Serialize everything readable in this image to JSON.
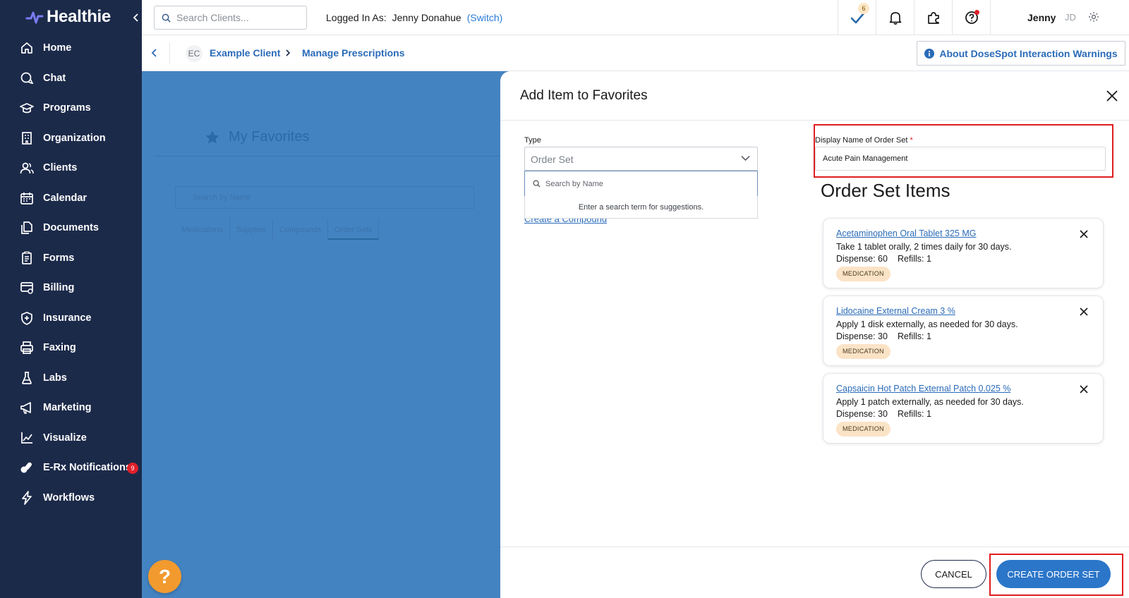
{
  "brand": {
    "name": "Healthie"
  },
  "sidebar": {
    "items": [
      {
        "label": "Home",
        "icon": "home-icon"
      },
      {
        "label": "Chat",
        "icon": "chat-icon"
      },
      {
        "label": "Programs",
        "icon": "programs-icon"
      },
      {
        "label": "Organization",
        "icon": "building-icon"
      },
      {
        "label": "Clients",
        "icon": "users-icon"
      },
      {
        "label": "Calendar",
        "icon": "calendar-icon"
      },
      {
        "label": "Documents",
        "icon": "documents-icon"
      },
      {
        "label": "Forms",
        "icon": "forms-icon"
      },
      {
        "label": "Billing",
        "icon": "billing-icon"
      },
      {
        "label": "Insurance",
        "icon": "shield-icon"
      },
      {
        "label": "Faxing",
        "icon": "printer-icon"
      },
      {
        "label": "Labs",
        "icon": "flask-icon"
      },
      {
        "label": "Marketing",
        "icon": "megaphone-icon"
      },
      {
        "label": "Visualize",
        "icon": "chart-icon"
      },
      {
        "label": "E-Rx Notifications",
        "icon": "pills-icon",
        "badge": "9"
      },
      {
        "label": "Workflows",
        "icon": "lightning-icon"
      }
    ]
  },
  "topbar": {
    "search_placeholder": "Search Clients...",
    "logged_in_label": "Logged In As:",
    "user_full_name": "Jenny Donahue",
    "switch_label": "(Switch)",
    "tasks_count": "6",
    "user_first_name": "Jenny",
    "user_initials": "JD"
  },
  "subbar": {
    "client_initials": "EC",
    "client_name": "Example Client",
    "page_name": "Manage Prescriptions",
    "about_button": "About DoseSpot Interaction Warnings"
  },
  "background": {
    "title": "My Favorites",
    "search_placeholder": "Search by Name",
    "tabs": [
      "Medications",
      "Supplies",
      "Compounds",
      "Order Sets"
    ]
  },
  "modal": {
    "title": "Add Item to Favorites",
    "type_label": "Type",
    "type_value": "Order Set",
    "dropdown_search_placeholder": "Search by Name",
    "dropdown_hint": "Enter a search term for suggestions.",
    "hidden_link": "Create a Compound",
    "display_name_label": "Display Name of Order Set",
    "required_mark": "*",
    "display_name_value": "Acute Pain Management",
    "order_set_items_title": "Order Set Items",
    "items": [
      {
        "name": "Acetaminophen Oral Tablet 325 MG",
        "directions": "Take 1 tablet orally, 2 times daily for 30 days.",
        "dispense": "Dispense: 60",
        "refills": "Refills: 1",
        "tag": "MEDICATION"
      },
      {
        "name": "Lidocaine External Cream 3 %",
        "directions": "Apply 1 disk externally, as needed for 30 days.",
        "dispense": "Dispense: 30",
        "refills": "Refills: 1",
        "tag": "MEDICATION"
      },
      {
        "name": "Capsaicin Hot Patch External Patch 0.025 %",
        "directions": "Apply 1 patch externally, as needed for 30 days.",
        "dispense": "Dispense: 30",
        "refills": "Refills: 1",
        "tag": "MEDICATION"
      }
    ],
    "cancel_button": "CANCEL",
    "create_button": "CREATE ORDER SET"
  },
  "help_button": "?",
  "colors": {
    "sidebar": "#1c2a4a",
    "accent": "#2b76c9",
    "overlay": "#4483c1",
    "highlight": "#e01e1e",
    "tag": "#fbe3c6"
  }
}
